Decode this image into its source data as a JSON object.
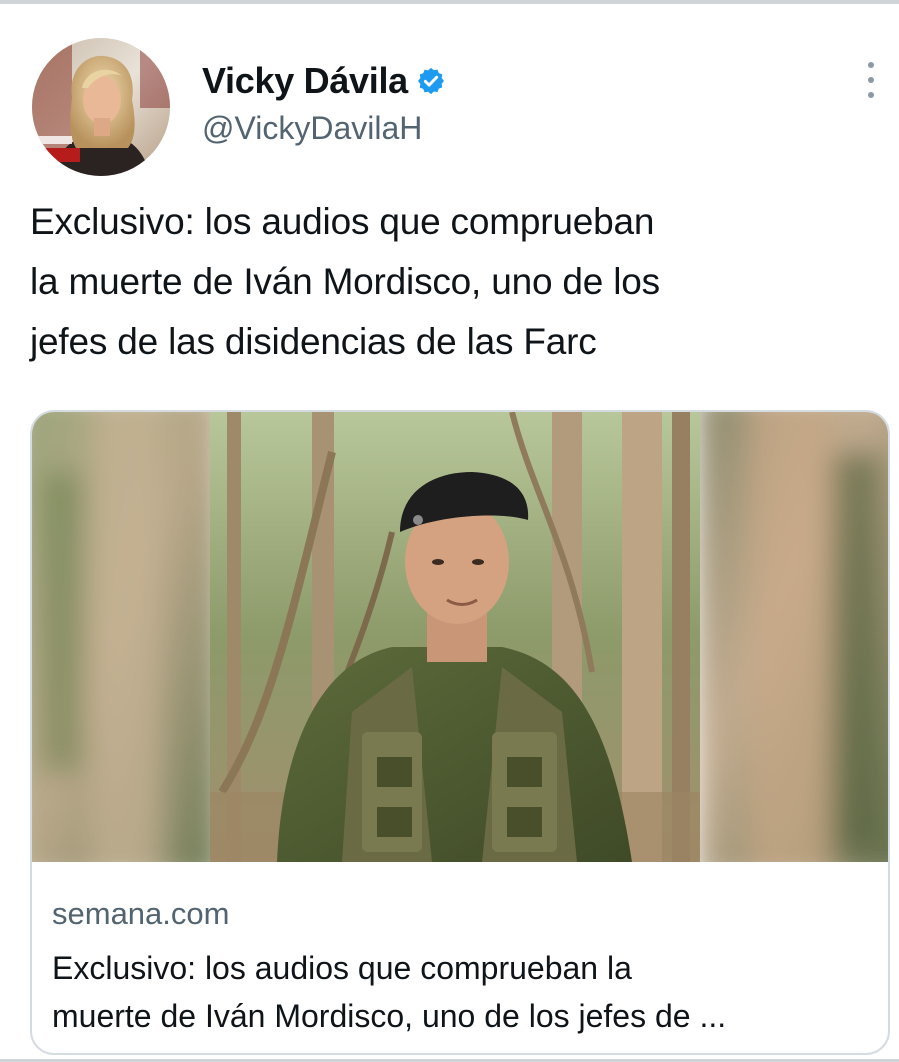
{
  "author": {
    "display_name": "Vicky Dávila",
    "handle": "@VickyDavilaH",
    "verified": true,
    "verified_color": "#1d9bf0"
  },
  "tweet": {
    "text_lines": [
      "Exclusivo: los audios que comprueban",
      "la muerte de Iván Mordisco, uno de los",
      "jefes de las disidencias de las Farc"
    ]
  },
  "card": {
    "domain": "semana.com",
    "title_lines": [
      "Exclusivo: los audios que comprueban la",
      "muerte de Iván Mordisco, uno de los jefes de ..."
    ]
  },
  "icons": {
    "more": "more-options-icon",
    "verified": "verified-badge-icon"
  }
}
